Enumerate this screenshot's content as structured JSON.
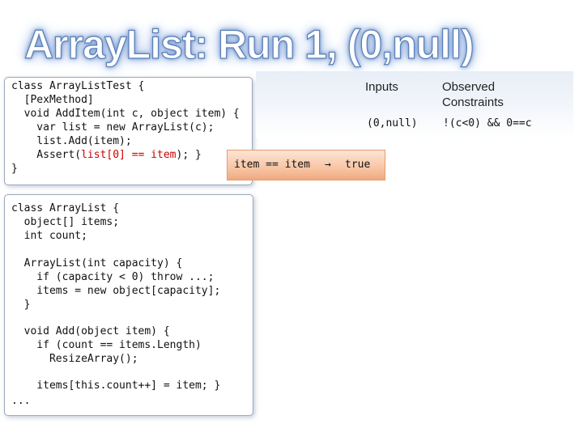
{
  "slide": {
    "title": "ArrayList: Run 1, (0,null)"
  },
  "code_test": {
    "lines": [
      "class ArrayListTest {",
      "  [PexMethod]",
      "  void AddItem(int c, object item) {",
      "    var list = new ArrayList(c);",
      "    list.Add(item);",
      "    Assert(",
      "list[0] == item",
      "); }",
      "}"
    ]
  },
  "code_list": {
    "lines": [
      "class ArrayList {",
      "  object[] items;",
      "  int count;",
      "  ArrayList(int capacity) {",
      "    if (capacity < 0) throw ...;",
      "    items = new object[capacity];",
      "  }",
      "  void Add(object item) {",
      "    if (count == items.Length)",
      "      ResizeArray();",
      "    items[this.count++] = item; }",
      "..."
    ]
  },
  "table": {
    "headers": {
      "inputs": "Inputs",
      "constraints": "Observed Constraints"
    },
    "rows": [
      {
        "inputs": "(0,null)",
        "constraints": "!(c<0) && 0==c"
      }
    ]
  },
  "derived": {
    "condition": "item == item",
    "arrow": "→",
    "result": "true"
  },
  "colors": {
    "highlight": "#cc0000",
    "title_glow": "#5a7fb8",
    "arrow_box": "#f8c5a4",
    "table_bg": "#e8eef7"
  }
}
